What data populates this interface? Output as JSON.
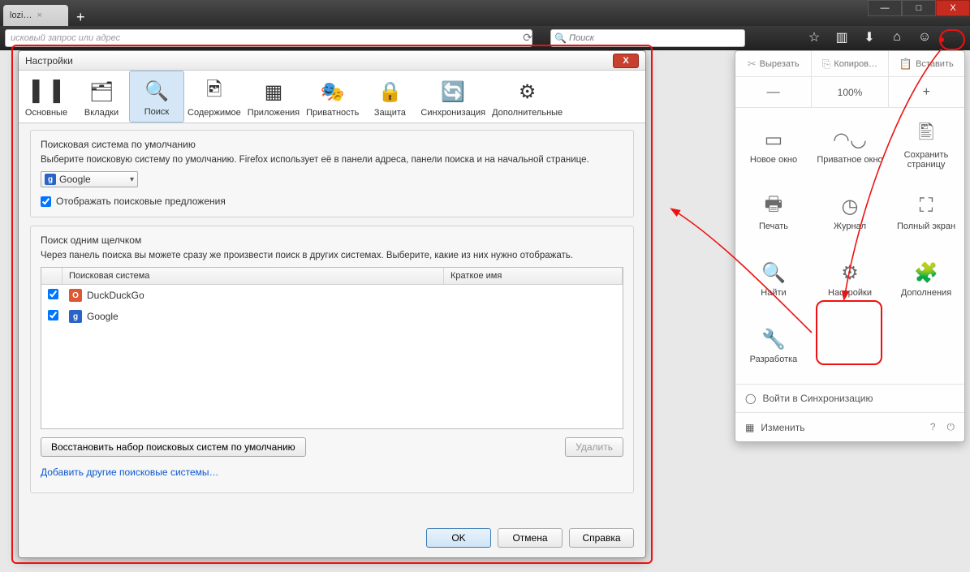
{
  "chrome": {
    "tab_title": "lozi…",
    "min": "—",
    "max": "□",
    "close": "X"
  },
  "navbar": {
    "url_placeholder": "исковый запрос или адрес",
    "search_placeholder": "Поиск"
  },
  "menu": {
    "edit": {
      "cut": "Вырезать",
      "copy": "Копиров…",
      "paste": "Вставить"
    },
    "zoom": {
      "minus": "—",
      "level": "100%",
      "plus": "+"
    },
    "items": [
      {
        "label": "Новое окно",
        "icon": "window-icon"
      },
      {
        "label": "Приватное окно",
        "icon": "mask-icon"
      },
      {
        "label": "Сохранить страницу",
        "icon": "page-icon"
      },
      {
        "label": "Печать",
        "icon": "printer-icon"
      },
      {
        "label": "Журнал",
        "icon": "clock-icon"
      },
      {
        "label": "Полный экран",
        "icon": "fullscreen-icon"
      },
      {
        "label": "Найти",
        "icon": "search-icon"
      },
      {
        "label": "Настройки",
        "icon": "gear-icon"
      },
      {
        "label": "Дополнения",
        "icon": "puzzle-icon"
      },
      {
        "label": "Разработка",
        "icon": "wrench-icon"
      }
    ],
    "sync": "Войти в Синхронизацию",
    "customize": "Изменить"
  },
  "dialog": {
    "title": "Настройки",
    "tabs": [
      {
        "label": "Основные",
        "icon": "switch-icon"
      },
      {
        "label": "Вкладки",
        "icon": "tabs-icon"
      },
      {
        "label": "Поиск",
        "icon": "magnifier-icon"
      },
      {
        "label": "Содержимое",
        "icon": "content-icon"
      },
      {
        "label": "Приложения",
        "icon": "apps-icon"
      },
      {
        "label": "Приватность",
        "icon": "privacy-icon"
      },
      {
        "label": "Защита",
        "icon": "lock-icon"
      },
      {
        "label": "Синхронизация",
        "icon": "sync-icon"
      },
      {
        "label": "Дополнительные",
        "icon": "advanced-gear-icon"
      }
    ],
    "active_tab_index": 2,
    "group1": {
      "heading": "Поисковая система по умолчанию",
      "desc": "Выберите поисковую систему по умолчанию. Firefox использует её в панели адреса, панели поиска и на начальной странице.",
      "selected_engine": "Google",
      "checkbox_label": "Отображать поисковые предложения",
      "checkbox_checked": true
    },
    "group2": {
      "heading": "Поиск одним щелчком",
      "desc": "Через панель поиска вы можете сразу же произвести поиск в других системах. Выберите, какие из них нужно отображать.",
      "cols": {
        "name": "Поисковая система",
        "short": "Краткое имя"
      },
      "engines": [
        {
          "name": "DuckDuckGo",
          "checked": true,
          "icon": "ddg"
        },
        {
          "name": "Google",
          "checked": true,
          "icon": "ggl"
        }
      ],
      "restore_btn": "Восстановить набор поисковых систем по умолчанию",
      "delete_btn": "Удалить",
      "link": "Добавить другие поисковые системы…"
    },
    "buttons": {
      "ok": "OK",
      "cancel": "Отмена",
      "help": "Справка"
    }
  }
}
